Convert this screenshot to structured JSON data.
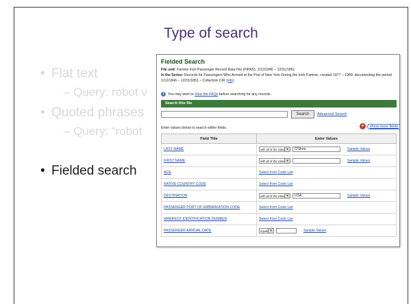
{
  "slide": {
    "title": "Type of search",
    "bullets": [
      {
        "text": "Flat text",
        "level": 1,
        "active": false
      },
      {
        "text": "– Query: robot v",
        "level": 2,
        "active": false
      },
      {
        "text": "Quoted phrases",
        "level": 1,
        "active": false
      },
      {
        "text": "– Query: “robot",
        "level": 2,
        "active": false
      },
      {
        "text": "Fielded search",
        "level": 1,
        "active": true
      }
    ]
  },
  "screenshot": {
    "heading": "Fielded Search",
    "file_unit_label": "File unit:",
    "file_unit_value": "Famine Irish Passenger Record Data File (FIPAS), 1/12/1846 – 12/31/1851",
    "series_label": "In the Series:",
    "series_value": "Records for Passengers Who Arrived at the Port of New York During the Irish Famine, created 1977 – 1989, documenting the period 1/12/1846 – 12/31/1851 – Collection CIR",
    "series_link": "(info)",
    "info_prefix": "You may wish to",
    "info_link": "View the FAQs",
    "info_suffix": "before searching for any records.",
    "search_bar_title": "Search this file",
    "search_button": "Search",
    "advanced_link": "Advanced Search",
    "enter_note": "Enter values below to search within fields.",
    "show_more": "show more fields",
    "table_headers": [
      "Field Title",
      "Enter Values"
    ],
    "rows": [
      {
        "field": "LAST NAME",
        "operator": "with all of the values",
        "value": "O'Shea",
        "sample": "Sample Values"
      },
      {
        "field": "FIRST NAME",
        "operator": "with all of the values",
        "value": "",
        "sample": "Sample Values"
      },
      {
        "field": "AGE",
        "code_list": "Select from Code List"
      },
      {
        "field": "NATIVE COUNTRY CODE",
        "code_list": "Select from Code List"
      },
      {
        "field": "DESTINATION",
        "operator": "with all of the values",
        "value": "USA",
        "sample": "Sample Values"
      },
      {
        "field": "PASSENGER PORT OF EMBARKATION CODE",
        "code_list": "Select from Code List"
      },
      {
        "field": "MANIFEST IDENTIFICATION NUMBER",
        "code_list": "Select from Code List"
      },
      {
        "field": "PASSENGER ARRIVAL DATE",
        "operator": "equals",
        "value": "",
        "sample": "Sample Values"
      }
    ]
  },
  "colors": {
    "title": "#4a2d80",
    "green_bar": "#3c7a3a",
    "link": "#1f4aa3",
    "faded": "#d8d8d8"
  }
}
